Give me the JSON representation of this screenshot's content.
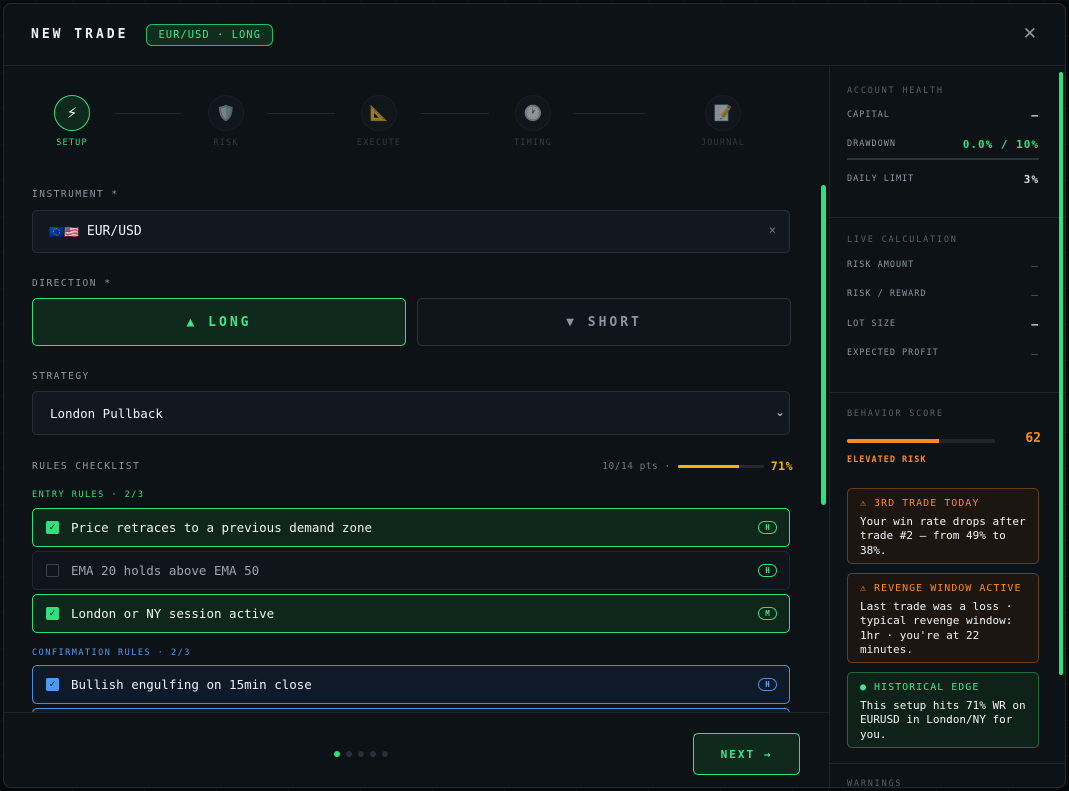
{
  "header": {
    "title": "NEW TRADE",
    "badge": "EUR/USD · LONG",
    "close": "✕"
  },
  "stepper": [
    {
      "icon": "⚡",
      "label": "SETUP",
      "state": "active"
    },
    {
      "icon": "🛡️",
      "label": "RISK",
      "state": "dim"
    },
    {
      "icon": "📐",
      "label": "EXECUTE",
      "state": "dim"
    },
    {
      "icon": "🕐",
      "label": "TIMING",
      "state": "dim"
    },
    {
      "icon": "📝",
      "label": "JOURNAL",
      "state": "dim"
    }
  ],
  "form": {
    "instrument_label": "INSTRUMENT *",
    "instrument_flags": "🇪🇺🇺🇸",
    "instrument_value": "EUR/USD",
    "instrument_clear": "×",
    "direction_label": "DIRECTION *",
    "long_label": "▲ LONG",
    "short_label": "▼ SHORT",
    "strategy_label": "STRATEGY",
    "strategy_value": "London Pullback",
    "rules_label": "RULES CHECKLIST",
    "points": "10/14 pts ·",
    "percent": "71%",
    "percent_value": 0.71
  },
  "entry_rules": {
    "title": "ENTRY RULES · 2/3",
    "items": [
      {
        "text": "Price retraces to a previous demand zone",
        "tag": "H",
        "checked": true
      },
      {
        "text": "EMA 20 holds above EMA 50",
        "tag": "H",
        "checked": false
      },
      {
        "text": "London or NY session active",
        "tag": "M",
        "checked": true
      }
    ]
  },
  "confirmation_rules": {
    "title": "CONFIRMATION RULES · 2/3",
    "items": [
      {
        "text": "Bullish engulfing on 15min close",
        "tag": "H",
        "checked": true
      }
    ]
  },
  "footer": {
    "next_label": "NEXT →",
    "page_dots": 5,
    "active_dot": 1
  },
  "account": {
    "title": "ACCOUNT HEALTH",
    "capital_label": "CAPITAL",
    "capital_value": "—",
    "drawdown_label": "DRAWDOWN",
    "drawdown_value": "0.0% / 10%",
    "daily_label": "DAILY LIMIT",
    "daily_value": "3%"
  },
  "live": {
    "title": "LIVE CALCULATION",
    "risk_amount_label": "RISK AMOUNT",
    "risk_amount_value": "—",
    "rr_label": "RISK / REWARD",
    "rr_value": "—",
    "lot_label": "LOT SIZE",
    "lot_value": "—",
    "profit_label": "EXPECTED PROFIT",
    "profit_value": "—"
  },
  "behavior": {
    "title": "BEHAVIOR SCORE",
    "score": "62",
    "score_value": 62,
    "risk_label": "ELEVATED RISK",
    "cards": [
      {
        "type": "warn",
        "title": "⚠ 3RD TRADE TODAY",
        "body": "Your win rate drops after trade #2 — from 49% to 38%."
      },
      {
        "type": "warn",
        "title": "⚠ REVENGE WINDOW ACTIVE",
        "body": "Last trade was a loss · typical revenge window: 1hr · you're at 22 minutes."
      },
      {
        "type": "good",
        "title": "● HISTORICAL EDGE",
        "body": "This setup hits 71% WR on EURUSD in London/NY for you."
      }
    ]
  },
  "warnings": {
    "title": "WARNINGS"
  },
  "colors": {
    "accent": "#2ee07e",
    "warning": "#ff8a1c",
    "gold": "#f0b21c",
    "blue": "#4a8fe0"
  }
}
